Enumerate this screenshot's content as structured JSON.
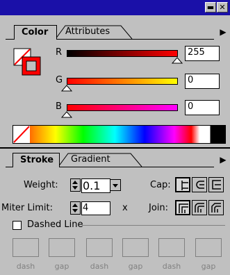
{
  "titlebar": {
    "minimize_glyph": "▬",
    "close_glyph": "✕"
  },
  "color_panel": {
    "tabs": [
      {
        "label": "Color"
      },
      {
        "label": "Attributes"
      }
    ],
    "menu_arrow": "▶",
    "sliders": [
      {
        "label": "R",
        "value": "255",
        "fraction": 1.0
      },
      {
        "label": "G",
        "value": "0",
        "fraction": 0.0
      },
      {
        "label": "B",
        "value": "0",
        "fraction": 0.0
      }
    ]
  },
  "stroke_panel": {
    "tabs": [
      {
        "label": "Stroke"
      },
      {
        "label": "Gradient"
      }
    ],
    "menu_arrow": "▶",
    "weight_label": "Weight:",
    "weight_value": "0.1",
    "cap_label": "Cap:",
    "miter_label": "Miter Limit:",
    "miter_value": "4",
    "miter_unit": "x",
    "join_label": "Join:",
    "dashed_line_label": "Dashed Line",
    "dash_fields": [
      {
        "label": "dash"
      },
      {
        "label": "gap"
      },
      {
        "label": "dash"
      },
      {
        "label": "gap"
      },
      {
        "label": "dash"
      },
      {
        "label": "gap"
      }
    ]
  },
  "colors": {
    "titlebar": "#1a10a8",
    "panel": "#c0c0c0",
    "stroke_swatch": "#ff0000"
  }
}
